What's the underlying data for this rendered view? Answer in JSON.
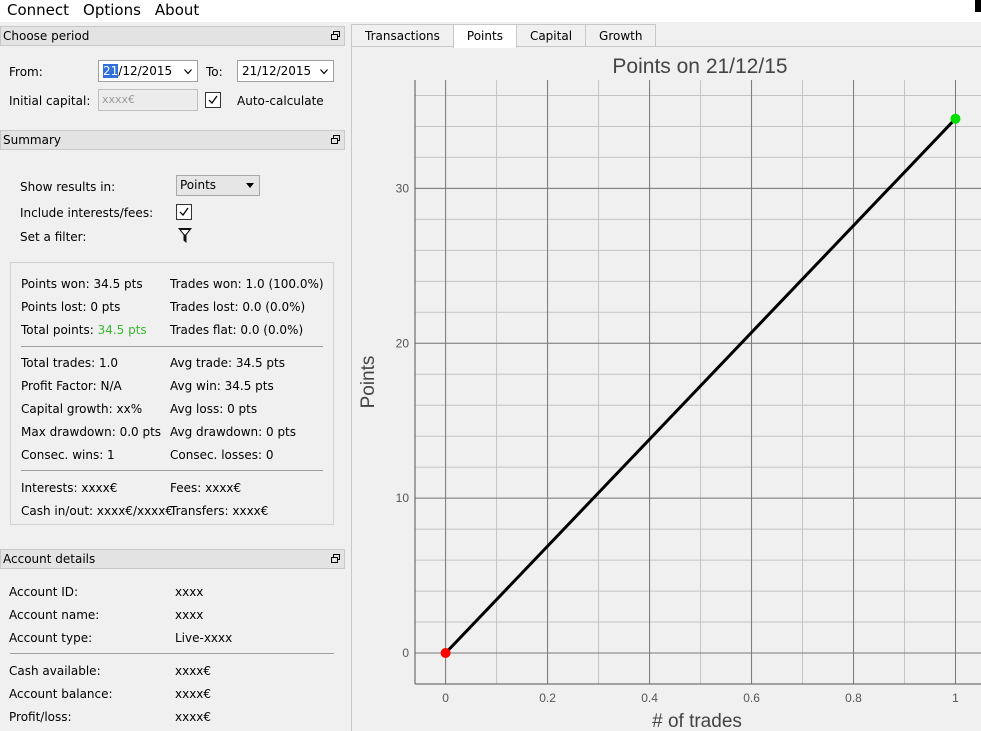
{
  "menu": [
    "Connect",
    "Options",
    "About"
  ],
  "period": {
    "title": "Choose period",
    "from_label": "From:",
    "from_value_day": "21",
    "from_value_rest": "/12/2015",
    "to_label": "To:",
    "to_value": "21/12/2015",
    "initial_capital_label": "Initial capital:",
    "initial_capital_placeholder": "xxxx€",
    "auto_calculate_label": "Auto-calculate",
    "auto_calculate_checked": true
  },
  "summary": {
    "title": "Summary",
    "show_results_label": "Show results in:",
    "show_results_value": "Points",
    "include_interests_label": "Include interests/fees:",
    "include_interests_checked": true,
    "filter_label": "Set a filter:",
    "stats": {
      "points_won": "Points won: 34.5 pts",
      "trades_won": "Trades won: 1.0 (100.0%)",
      "points_lost": "Points lost: 0 pts",
      "trades_lost": "Trades lost: 0.0 (0.0%)",
      "total_points_label": "Total points: ",
      "total_points_value": "34.5 pts",
      "trades_flat": "Trades flat: 0.0 (0.0%)",
      "total_trades": "Total trades: 1.0",
      "avg_trade": "Avg trade: 34.5 pts",
      "profit_factor": "Profit Factor: N/A",
      "avg_win": "Avg win: 34.5 pts",
      "capital_growth": "Capital growth: xx%",
      "avg_loss": "Avg loss: 0 pts",
      "max_drawdown": "Max drawdown: 0.0 pts",
      "avg_drawdown": "Avg drawdown: 0 pts",
      "consec_wins": "Consec. wins: 1",
      "consec_losses": "Consec. losses: 0",
      "interests": "Interests: xxxx€",
      "fees": "Fees: xxxx€",
      "cash_inout": "Cash in/out: xxxx€/xxxx€",
      "transfers": "Transfers: xxxx€"
    },
    "colors": {
      "positive": "#3cb832"
    }
  },
  "account": {
    "title": "Account details",
    "rows": [
      {
        "label": "Account ID:",
        "value": "xxxx"
      },
      {
        "label": "Account name:",
        "value": "xxxx"
      },
      {
        "label": "Account type:",
        "value": "Live-xxxx"
      },
      {
        "label": "Cash available:",
        "value": "xxxx€"
      },
      {
        "label": "Account balance:",
        "value": "xxxx€"
      },
      {
        "label": "Profit/loss:",
        "value": "xxxx€"
      }
    ]
  },
  "tabs": [
    {
      "label": "Transactions",
      "active": false
    },
    {
      "label": "Points",
      "active": true
    },
    {
      "label": "Capital",
      "active": false
    },
    {
      "label": "Growth",
      "active": false
    }
  ],
  "chart_data": {
    "type": "line",
    "title": "Points on 21/12/15",
    "xlabel": "# of trades",
    "ylabel": "Points",
    "x": [
      0,
      1
    ],
    "y": [
      0,
      34.5
    ],
    "xlim": [
      -0.06,
      1.05
    ],
    "ylim": [
      -2,
      37
    ],
    "xticks": [
      0,
      0.2,
      0.4,
      0.6,
      0.8,
      1
    ],
    "xtick_labels": [
      "0",
      "0.2",
      "0.4",
      "0.6",
      "0.8",
      "1"
    ],
    "yticks": [
      0,
      10,
      20,
      30
    ],
    "ytick_labels": [
      "0",
      "10",
      "20",
      "30"
    ],
    "grid": true,
    "line_color": "#000000",
    "start_marker_color": "#ff0000",
    "end_marker_color": "#00e000"
  }
}
